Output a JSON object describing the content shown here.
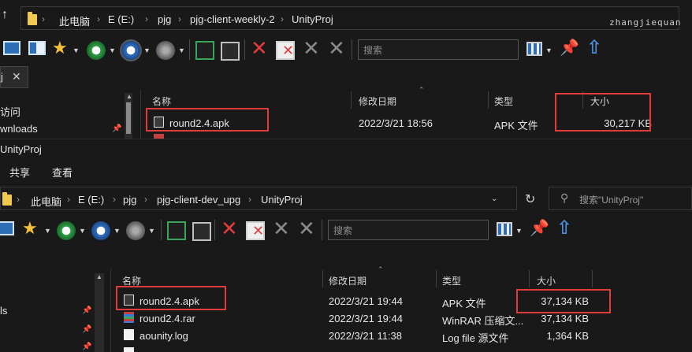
{
  "top": {
    "breadcrumb": [
      "此电脑",
      "E (E:)",
      "pjg",
      "pjg-client-weekly-2",
      "UnityProj"
    ],
    "user": "zhangjiequan",
    "search_placeholder": "搜索",
    "tab_label": "j",
    "nav": [
      "访问",
      "wnloads"
    ],
    "columns": {
      "name": "名称",
      "date": "修改日期",
      "type": "类型",
      "size": "大小"
    },
    "files": [
      {
        "name": "round2.4.apk",
        "date": "2022/3/21 18:56",
        "type": "APK 文件",
        "size": "30,217 KB"
      }
    ]
  },
  "bottom": {
    "title": "UnityProj",
    "menu": [
      "共享",
      "查看"
    ],
    "breadcrumb": [
      "此电脑",
      "E (E:)",
      "pjg",
      "pjg-client-dev_upg",
      "UnityProj"
    ],
    "search_placeholder": "搜索\"UnityProj\"",
    "toolbar_search_placeholder": "搜索",
    "nav": [
      "ls"
    ],
    "columns": {
      "name": "名称",
      "date": "修改日期",
      "type": "类型",
      "size": "大小"
    },
    "files": [
      {
        "name": "round2.4.apk",
        "date": "2022/3/21 19:44",
        "type": "APK 文件",
        "size": "37,134 KB"
      },
      {
        "name": "round2.4.rar",
        "date": "2022/3/21 19:44",
        "type": "WinRAR 压缩文...",
        "size": "37,134 KB"
      },
      {
        "name": "aounity.log",
        "date": "2022/3/21 11:38",
        "type": "Log file 源文件",
        "size": "1,364 KB"
      }
    ]
  },
  "colors": {
    "highlight": "#e23b3b",
    "background": "#191919",
    "folder": "#f2c94c"
  }
}
